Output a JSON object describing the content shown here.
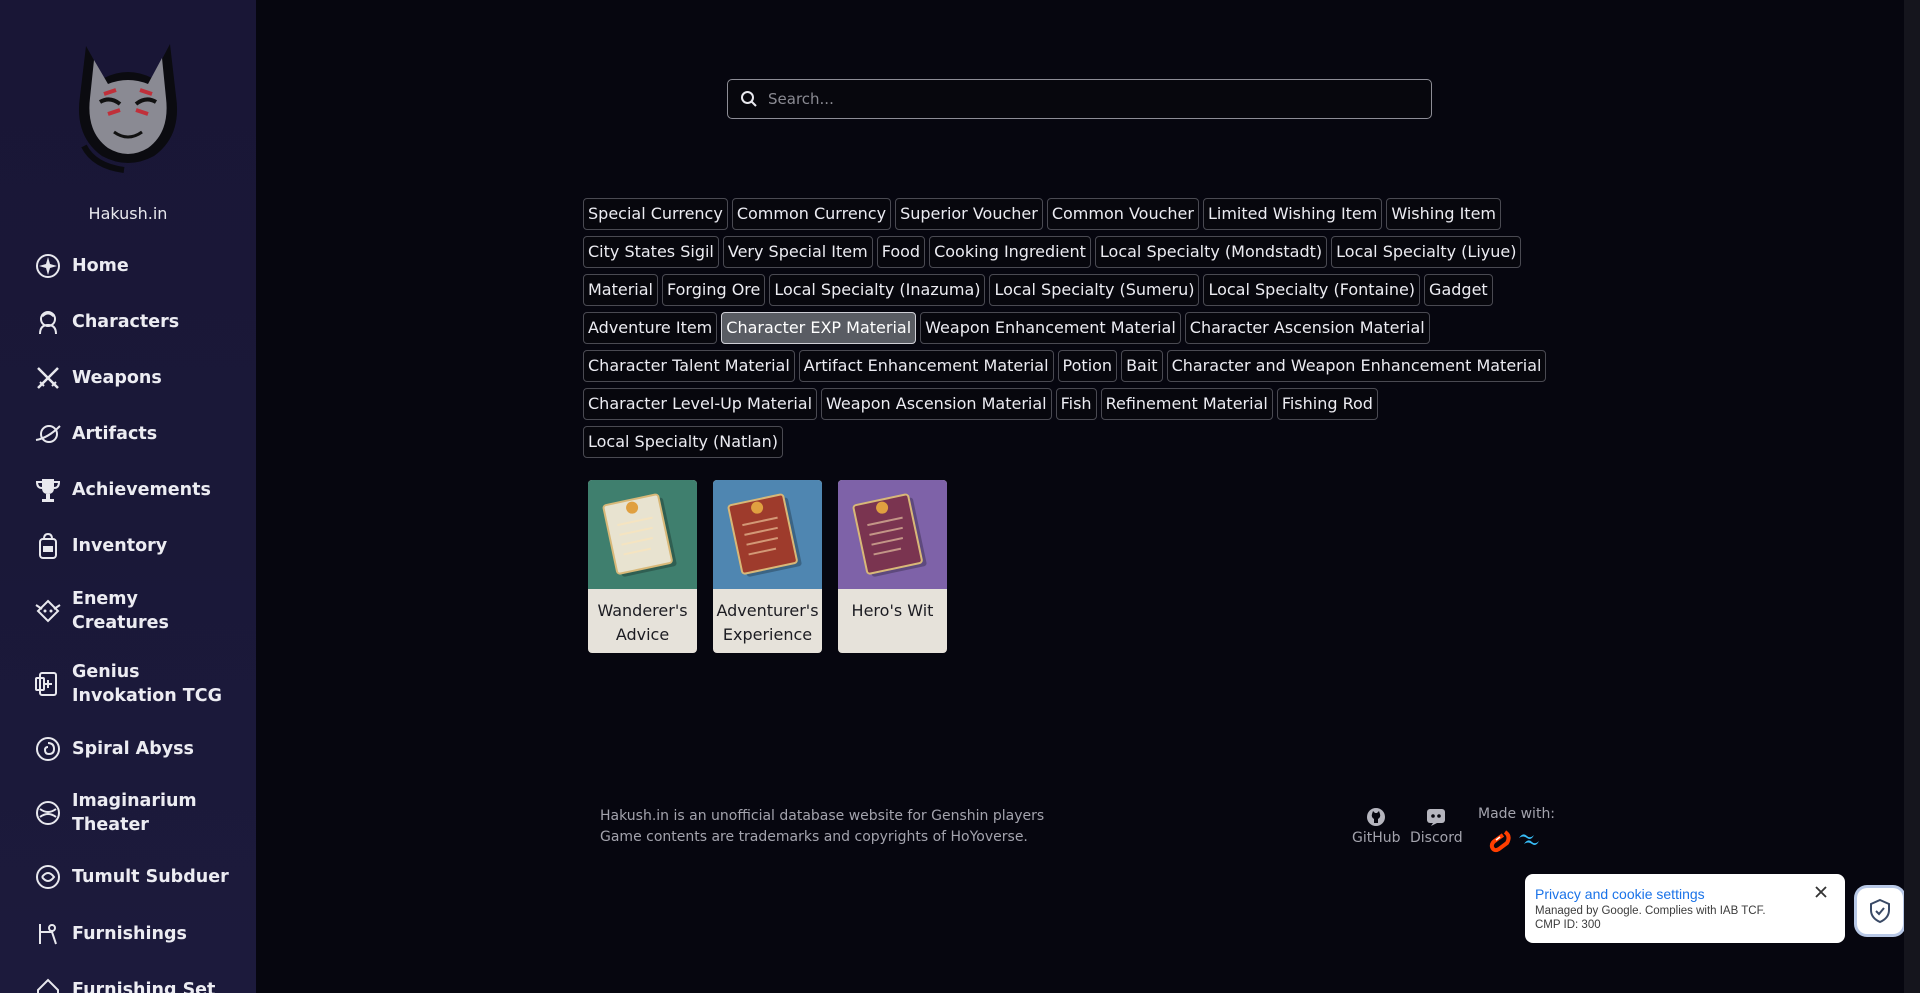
{
  "site": {
    "name": "Hakush.in"
  },
  "nav": [
    {
      "label": "Home",
      "icon": "home-icon"
    },
    {
      "label": "Characters",
      "icon": "characters-icon"
    },
    {
      "label": "Weapons",
      "icon": "weapons-icon"
    },
    {
      "label": "Artifacts",
      "icon": "artifacts-icon"
    },
    {
      "label": "Achievements",
      "icon": "trophy-icon"
    },
    {
      "label": "Inventory",
      "icon": "inventory-icon"
    },
    {
      "label": "Enemy Creatures",
      "icon": "enemy-icon"
    },
    {
      "label": "Genius Invokation TCG",
      "icon": "tcg-card-icon"
    },
    {
      "label": "Spiral Abyss",
      "icon": "spiral-abyss-icon"
    },
    {
      "label": "Imaginarium Theater",
      "icon": "imaginarium-theater-icon"
    },
    {
      "label": "Tumult Subduer",
      "icon": "tumult-subduer-icon"
    },
    {
      "label": "Furnishings",
      "icon": "furnishings-icon"
    },
    {
      "label": "Furnishing Set",
      "icon": "furnishing-set-icon"
    }
  ],
  "search": {
    "placeholder": "Search..."
  },
  "filters": [
    "Special Currency",
    "Common Currency",
    "Superior Voucher",
    "Common Voucher",
    "Limited Wishing Item",
    "Wishing Item",
    "City States Sigil",
    "Very Special Item",
    "Food",
    "Cooking Ingredient",
    "Local Specialty (Mondstadt)",
    "Local Specialty (Liyue)",
    "Material",
    "Forging Ore",
    "Local Specialty (Inazuma)",
    "Local Specialty (Sumeru)",
    "Local Specialty (Fontaine)",
    "Gadget",
    "Adventure Item",
    "Character EXP Material",
    "Weapon Enhancement Material",
    "Character Ascension Material",
    "Character Talent Material",
    "Artifact Enhancement Material",
    "Potion",
    "Bait",
    "Character and Weapon Enhancement Material",
    "Character Level-Up Material",
    "Weapon Ascension Material",
    "Fish",
    "Refinement Material",
    "Fishing Rod",
    "Local Specialty (Natlan)"
  ],
  "active_filter": "Character EXP Material",
  "items": [
    {
      "name": "Wanderer's Advice",
      "rarity_color": "#3f7f6e",
      "book_color": "#e8e3d0"
    },
    {
      "name": "Adventurer's Experience",
      "rarity_color": "#4f86b1",
      "book_color": "#9e3b2c"
    },
    {
      "name": "Hero's Wit",
      "rarity_color": "#7e62a8",
      "book_color": "#7a3450"
    }
  ],
  "footer": {
    "line1": "Hakush.in is an unofficial database website for Genshin players",
    "line2": "Game contents are trademarks and copyrights of HoYoverse.",
    "github": "GitHub",
    "discord": "Discord",
    "made_with": "Made with:"
  },
  "privacy": {
    "title": "Privacy and cookie settings",
    "desc1": "Managed by Google. Complies with IAB TCF.",
    "desc2": "CMP ID: 300"
  }
}
